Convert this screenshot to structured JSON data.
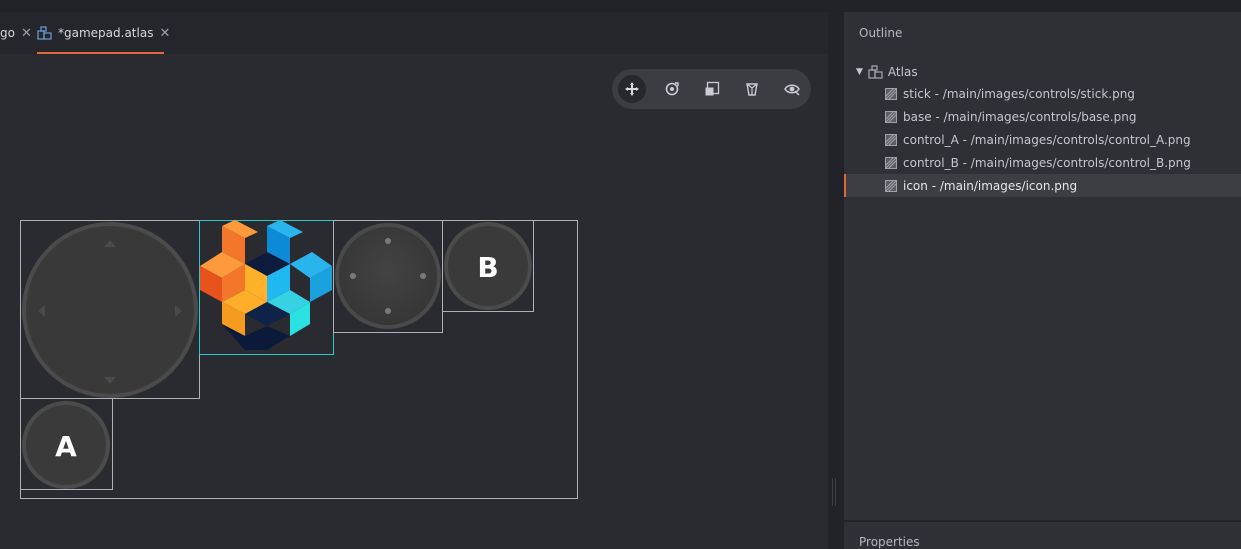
{
  "tabs": [
    {
      "label": "go",
      "close": "✕"
    },
    {
      "label": "*gamepad.atlas",
      "close": "✕",
      "active": true
    }
  ],
  "toolbar": {
    "tools": [
      {
        "name": "move-tool",
        "active": true
      },
      {
        "name": "rotate-tool"
      },
      {
        "name": "scale-tool"
      },
      {
        "name": "perspective-tool"
      },
      {
        "name": "visibility-tool"
      }
    ]
  },
  "atlas_images": {
    "control_a_label": "A",
    "control_b_label": "B"
  },
  "outline": {
    "title": "Outline",
    "root": {
      "label": "Atlas"
    },
    "items": [
      {
        "label": "stick - /main/images/controls/stick.png"
      },
      {
        "label": "base - /main/images/controls/base.png"
      },
      {
        "label": "control_A - /main/images/controls/control_A.png"
      },
      {
        "label": "control_B - /main/images/controls/control_B.png"
      },
      {
        "label": "icon - /main/images/icon.png",
        "selected": true
      }
    ]
  },
  "properties": {
    "title": "Properties"
  },
  "colors": {
    "accent": "#e0683a",
    "selection_outline": "#2ec8d0"
  }
}
